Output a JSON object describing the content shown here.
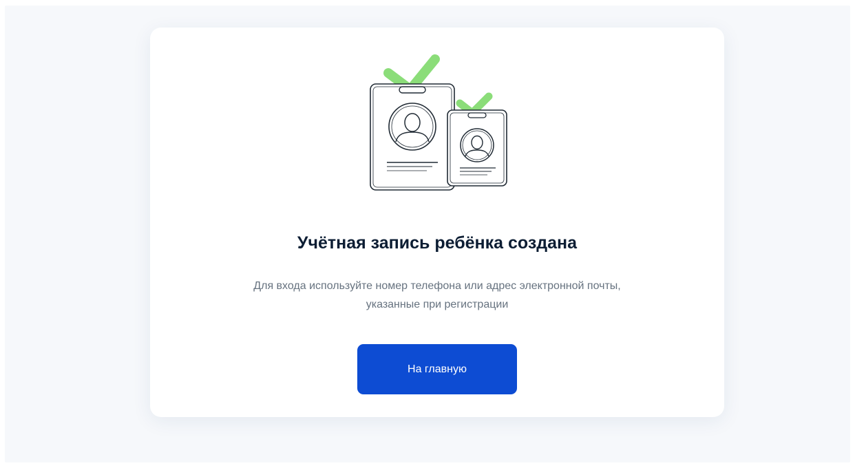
{
  "success": {
    "title": "Учётная запись ребёнка создана",
    "description_line1": "Для входа используйте номер телефона или адрес электронной почты,",
    "description_line2": "указанные при регистрации",
    "home_button_label": "На главную"
  },
  "illustration": {
    "icon": "id-badges-checkmark-icon",
    "check_color": "#7ed96a",
    "line_color": "#1f2933"
  },
  "colors": {
    "page_background": "#f6f8fb",
    "card_background": "#ffffff",
    "primary_button": "#0d4cd3",
    "title_text": "#0c1d33",
    "body_text": "#66727f"
  }
}
